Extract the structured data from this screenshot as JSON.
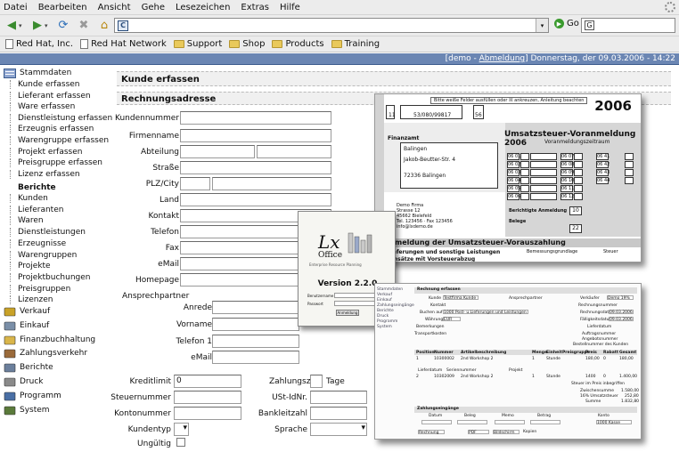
{
  "browser": {
    "menu": [
      "Datei",
      "Bearbeiten",
      "Ansicht",
      "Gehe",
      "Lesezeichen",
      "Extras",
      "Hilfe"
    ],
    "url_text": "",
    "go_label": "Go",
    "bookmarks": [
      {
        "label": "Red Hat, Inc.",
        "icon": "page-icon"
      },
      {
        "label": "Red Hat Network",
        "icon": "page-icon"
      },
      {
        "label": "Support",
        "icon": "folder-icon"
      },
      {
        "label": "Shop",
        "icon": "folder-icon"
      },
      {
        "label": "Products",
        "icon": "folder-icon"
      },
      {
        "label": "Training",
        "icon": "folder-icon"
      }
    ]
  },
  "status": {
    "prefix": "[demo - ",
    "logout": "Abmeldung",
    "suffix": "] Donnerstag, der 09.03.2006 - 14:22"
  },
  "sidebar": {
    "stammdaten": "Stammdaten",
    "items_a": [
      "Kunde erfassen",
      "Lieferant erfassen",
      "Ware erfassen",
      "Dienstleistung erfassen",
      "Erzeugnis erfassen",
      "Warengruppe erfassen",
      "Projekt erfassen",
      "Preisgruppe erfassen",
      "Lizenz erfassen"
    ],
    "berichte_head": "Berichte",
    "items_b": [
      "Kunden",
      "Lieferanten",
      "Waren",
      "Dienstleistungen",
      "Erzeugnisse",
      "Warengruppen",
      "Projekte",
      "Projektbuchungen",
      "Preisgruppen",
      "Lizenzen"
    ],
    "modules": [
      "Verkauf",
      "Einkauf",
      "Finanzbuchhaltung",
      "Zahlungsverkehr",
      "Berichte",
      "Druck",
      "Programm",
      "System"
    ]
  },
  "form": {
    "title": "Kunde erfassen",
    "section": "Rechnungsadresse",
    "labels": {
      "kundennummer": "Kundennummer",
      "firmenname": "Firmenname",
      "abteilung": "Abteilung",
      "strasse": "Straße",
      "plz_city": "PLZ/City",
      "land": "Land",
      "kontakt": "Kontakt",
      "telefon": "Telefon",
      "fax": "Fax",
      "email": "eMail",
      "homepage": "Homepage",
      "ansprechpartner": "Ansprechpartner",
      "anrede": "Anrede",
      "vorname": "Vorname",
      "telefon1": "Telefon 1",
      "ap_email": "eMail",
      "kreditlimit": "Kreditlimit",
      "zahlungsziel": "Zahlungsziel",
      "tage": "Tage",
      "steuernummer": "Steuernummer",
      "ustid": "USt-IdNr.",
      "kontonummer": "Kontonummer",
      "bankleitzahl": "Bankleitzahl",
      "kundentyp": "Kundentyp",
      "sprache": "Sprache",
      "ungueltig": "Ungültig"
    },
    "values": {
      "kreditlimit": "0"
    }
  },
  "ust_form": {
    "year": "2006",
    "title": "Umsatzsteuer-Voranmeldung 2006",
    "subtitle": "Voranmeldungszeitraum",
    "steuernummer": "53/080/99817",
    "finanzamt": "Finanzamt",
    "fa_name": "Balingen",
    "fa_street": "Jakob-Beutter-Str. 4",
    "fa_city": "72336 Balingen",
    "company": "Demo Firma",
    "company_street": "Strasse 12",
    "company_city": "45662 Bielefeld",
    "company_tel": "Tel. 123456 · Fax 123456",
    "company_mail": "info@lxdemo.de",
    "row_codes": [
      "06 01",
      "06 02",
      "06 03",
      "06 04",
      "06 05",
      "06 06"
    ],
    "row_codes_b": [
      "06 07",
      "06 08",
      "06 09",
      "06 10",
      "06 11",
      "06 12"
    ],
    "row_codes_c": [
      "06 41",
      "06 42",
      "06 43",
      "06 44"
    ],
    "berichtigte": "Berichtigte Anmeldung",
    "belege": "Belege",
    "berichtigte_val": "10",
    "belege_val": "22",
    "bottom_heading": "Anmeldung der Umsatzsteuer-Vorauszahlung",
    "bottom_sub": "Lieferungen und sonstige Leistungen",
    "bottom_sub2": "Umsätze mit Vorsteuerabzug",
    "col_bemessung": "Bemessungsgrundlage",
    "col_steuer": "Steuer",
    "top_note": "Bitte weiße Felder ausfüllen oder ☒ ankreuzen, Anleitung beachten",
    "fallnr": "11",
    "zeitraum": "56"
  },
  "splash": {
    "logo": "Lx",
    "logo_sub": "Office",
    "tagline": "Enterprise Resource Planning",
    "version": "Version 2.2.0",
    "user_label": "Benutzername",
    "pass_label": "Passwort",
    "button": "Anmeldung"
  },
  "screen2": {
    "header": "Rechnung erfassen",
    "kunde_label": "Kunde",
    "kunde_val": "Testfirma Kunde",
    "kontakt_label": "Kontakt",
    "ansprechpartner": "Ansprechpartner",
    "verkaeufer": "Verkäufer",
    "verkaeufer_val": "Demo 19%",
    "rechnungsnummer": "Rechnungsnummer",
    "rechnungsdatum": "Rechnungsdatum",
    "rechnungsdatum_val": "09.03.2006",
    "faelligkeitsdatum": "Fälligkeitsdatum",
    "faelligkeitsdatum_val": "09.03.2006",
    "lieferdatum": "Lieferdatum",
    "auftragsnummer": "Auftragsnummer",
    "angebotsnummer": "Angebotsnummer",
    "bestellnummer": "Bestellnummer des Kunden",
    "buchen_auf": "Buchen auf",
    "buchen_val": "1000 Post- u.Lieferungen und Leistungen",
    "waehrung": "Währung",
    "waehrung_val": "EUR",
    "bemerkungen": "Bemerkungen",
    "transportkosten": "Transportkosten",
    "cols": [
      "Position",
      "Nummer",
      "Artikelbeschreibung",
      "Menge",
      "Einheit",
      "Preisgruppe",
      "Preis",
      "Rabatt",
      "Gesamt"
    ],
    "row1": [
      "1",
      "10300002",
      "2nd Workshop 2",
      "1",
      "Stunde",
      "",
      "180,00",
      "0",
      "180,00"
    ],
    "row2": [
      "2",
      "10302009",
      "2nd Workshop 2",
      "1",
      "Stunde",
      "",
      "1400",
      "0",
      "1.400,00"
    ],
    "lieferdatum_row": "Lieferdatum",
    "seriennummer": "Seriennummer",
    "projekt": "Projekt",
    "steuer_in": "Steuer im Preis inbegriffen",
    "zwischensumme": "Zwischensumme",
    "zw_val": "1.580,00",
    "ust": "16% Umsatzsteuer",
    "ust_val": "252,80",
    "summe": "Summe",
    "summe_val": "1.832,80",
    "zahlungseingaenge": "Zahlungseingänge",
    "zahl_cols": [
      "Datum",
      "Beleg",
      "Memo",
      "Betrag",
      "Konto"
    ],
    "zahl_konto": "1000 Kasse",
    "footer_a": "Rechnung",
    "footer_b": "PDF",
    "footer_c": "Bildschirm",
    "footer_d": "Kopien",
    "side_menu": [
      "Stammdaten",
      "Verkauf",
      "Einkauf",
      "Zahlungseingänge",
      "Berichte",
      "Druck",
      "Programm",
      "System"
    ]
  },
  "colors": {
    "status_bg": "#6b86b3",
    "chrome_bg": "#ececec",
    "section_bg": "#f0f0f0"
  }
}
